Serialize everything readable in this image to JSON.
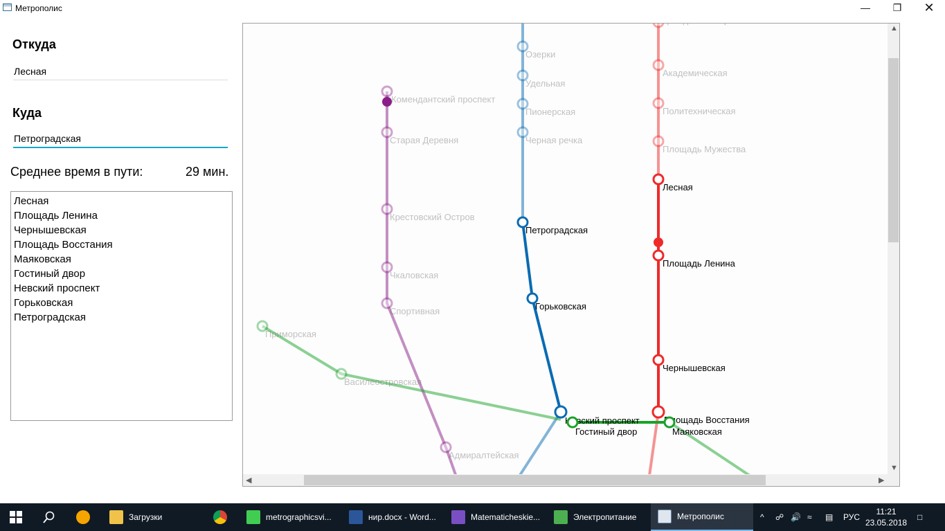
{
  "window": {
    "title": "Метрополис"
  },
  "form": {
    "from_label": "Откуда",
    "from_value": "Лесная",
    "to_label": "Куда",
    "to_value": "Петроградская",
    "time_label": "Среднее время в пути:",
    "time_value": "29 мин."
  },
  "route": [
    "Лесная",
    "Площадь Ленина",
    "Чернышевская",
    "Площадь Восстания",
    "Маяковская",
    "Гостиный двор",
    "Невский проспект",
    "Горьковская",
    "Петроградская"
  ],
  "colors": {
    "line1_red": "#ee2a2a",
    "line2_blue": "#0a6bb3",
    "line3_green": "#1aa32a",
    "line5_purple": "#8a1f88",
    "input_focus": "#16a6c9"
  },
  "map": {
    "stations": [
      {
        "name": "Гражданский проспект",
        "line": "red",
        "active": false
      },
      {
        "name": "Академическая",
        "line": "red",
        "active": false
      },
      {
        "name": "Политехническая",
        "line": "red",
        "active": false
      },
      {
        "name": "Площадь Мужества",
        "line": "red",
        "active": false
      },
      {
        "name": "Лесная",
        "line": "red",
        "active": true
      },
      {
        "name": "Площадь Ленина",
        "line": "red",
        "active": true
      },
      {
        "name": "Чернышевская",
        "line": "red",
        "active": true
      },
      {
        "name": "Площадь Восстания",
        "line": "red",
        "active": true
      },
      {
        "name": "Озерки",
        "line": "blue",
        "active": false
      },
      {
        "name": "Удельная",
        "line": "blue",
        "active": false
      },
      {
        "name": "Пионерская",
        "line": "blue",
        "active": false
      },
      {
        "name": "Черная речка",
        "line": "blue",
        "active": false
      },
      {
        "name": "Петроградская",
        "line": "blue",
        "active": true
      },
      {
        "name": "Горьковская",
        "line": "blue",
        "active": true
      },
      {
        "name": "Невский проспект",
        "line": "blue",
        "active": true
      },
      {
        "name": "Комендантский проспект",
        "line": "purple",
        "active": false
      },
      {
        "name": "Старая Деревня",
        "line": "purple",
        "active": false
      },
      {
        "name": "Крестовский Остров",
        "line": "purple",
        "active": false
      },
      {
        "name": "Чкаловская",
        "line": "purple",
        "active": false
      },
      {
        "name": "Спортивная",
        "line": "purple",
        "active": false
      },
      {
        "name": "Адмиралтейская",
        "line": "purple",
        "active": false
      },
      {
        "name": "Приморская",
        "line": "green",
        "active": false
      },
      {
        "name": "Василеостровская",
        "line": "green",
        "active": false
      },
      {
        "name": "Гостиный двор",
        "line": "green",
        "active": true
      },
      {
        "name": "Маяковская",
        "line": "green",
        "active": true
      }
    ]
  },
  "taskbar": {
    "items": [
      "Загрузки",
      "metrographicsvi...",
      "нир.docx - Word...",
      "Matematicheskie...",
      "Электропитание",
      "Метрополис"
    ],
    "lang": "РУС",
    "time": "11:21",
    "date": "23.05.2018"
  }
}
